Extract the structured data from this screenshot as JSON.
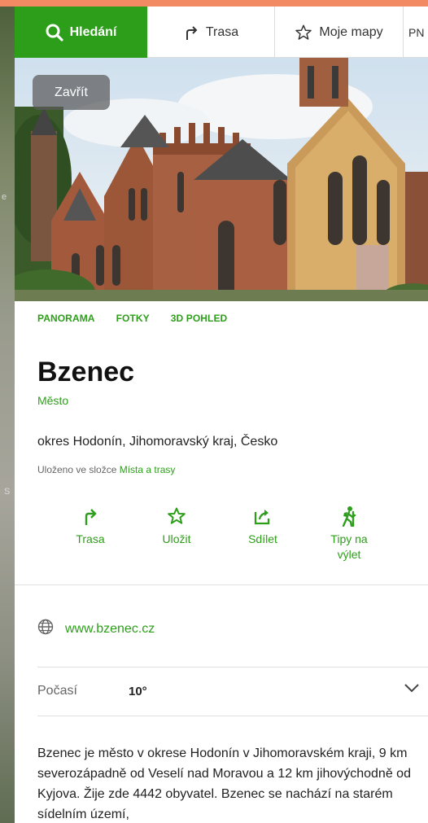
{
  "tabs": {
    "search_label": "Hledání",
    "route_label": "Trasa",
    "maps_label": "Moje mapy",
    "extra_label": "PN"
  },
  "photo": {
    "close_label": "Zavřít",
    "tabs": [
      "PANORAMA",
      "FOTKY",
      "3D POHLED"
    ]
  },
  "place": {
    "name": "Bzenec",
    "type": "Město",
    "region": "okres Hodonín, Jihomoravský kraj, Česko",
    "saved_prefix": "Uloženo ve složce ",
    "saved_folder": "Místa a trasy"
  },
  "actions": [
    {
      "label": "Trasa",
      "icon": "route-icon"
    },
    {
      "label": "Uložit",
      "icon": "star-icon"
    },
    {
      "label": "Sdílet",
      "icon": "share-icon"
    },
    {
      "label": "Tipy na výlet",
      "icon": "hiker-icon"
    }
  ],
  "website": "www.bzenec.cz",
  "weather": {
    "label": "Počasí",
    "value": "10°"
  },
  "description": "Bzenec je město v okrese Hodonín v Jihomoravském kraji, 9 km severozápadně od Veselí nad Moravou a 12 km jihovýchodně od Kyjova. Žije zde 4442 obyvatel. Bzenec se nachází na starém sídelním území,",
  "map_labels": [
    "e",
    "S"
  ],
  "colors": {
    "accent": "#2d9e1a",
    "top_strip": "#f28a64"
  }
}
